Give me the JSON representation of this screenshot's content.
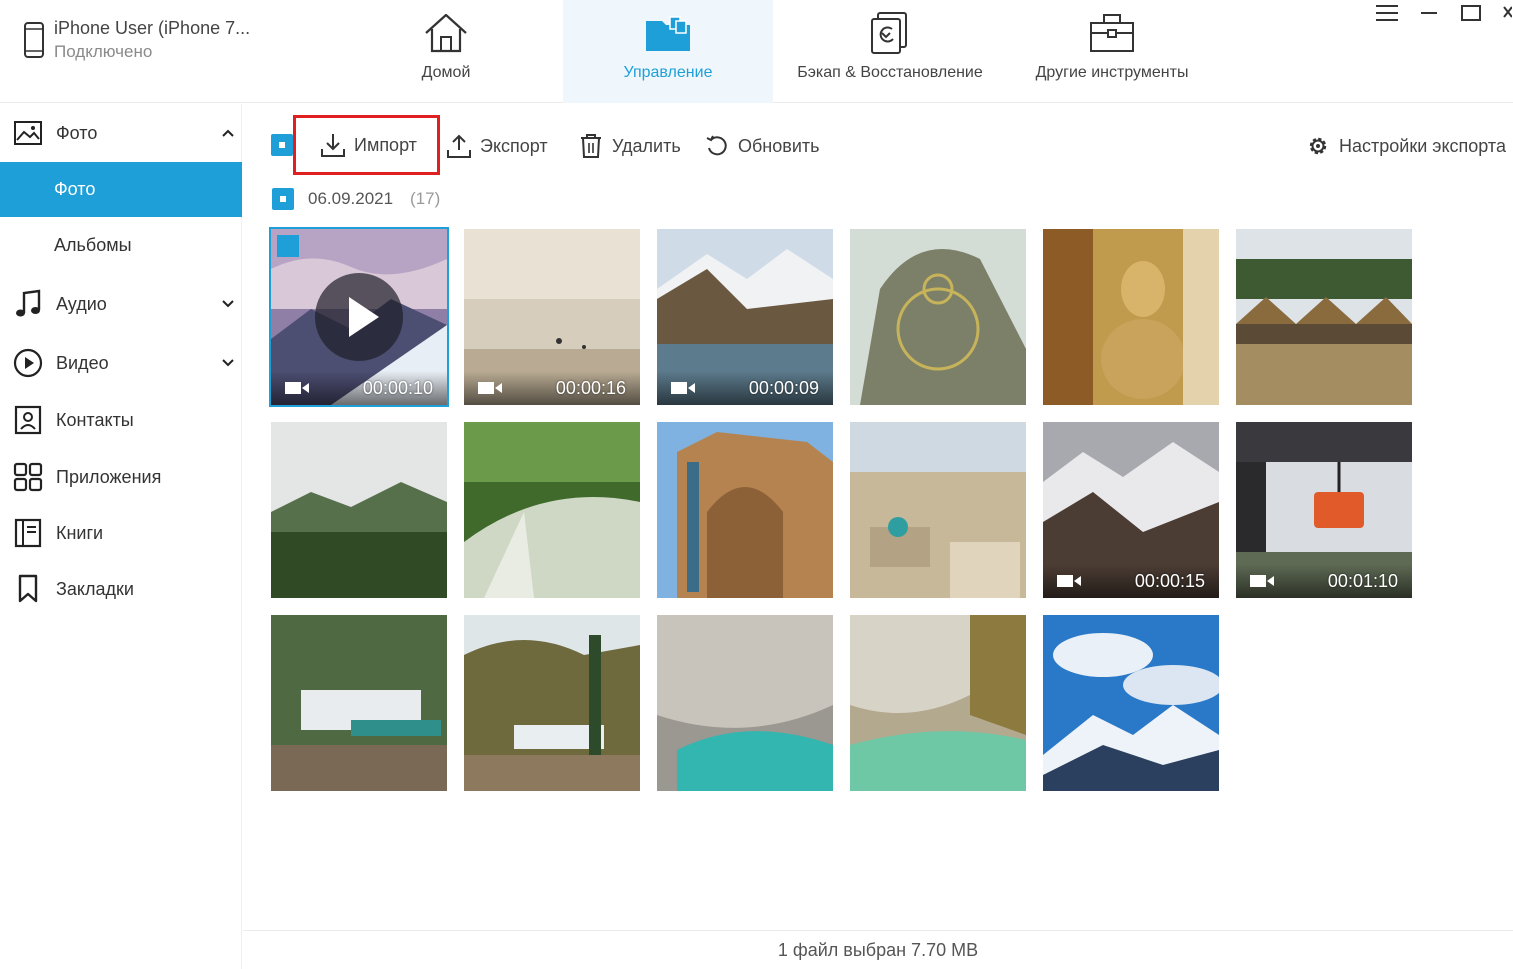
{
  "device": {
    "name": "iPhone User (iPhone 7...",
    "status": "Подключено"
  },
  "nav": {
    "tabs": [
      {
        "label": "Домой",
        "icon": "home-icon"
      },
      {
        "label": "Управление",
        "icon": "folder-icon",
        "active": true
      },
      {
        "label": "Бэкап & Восстановление",
        "icon": "backup-restore-icon"
      },
      {
        "label": "Другие инструменты",
        "icon": "toolbox-icon"
      }
    ]
  },
  "window_controls": [
    "menu-icon",
    "minimize-icon",
    "maximize-icon",
    "close-icon"
  ],
  "sidebar": {
    "items": [
      {
        "label": "Фото",
        "icon": "photo-icon",
        "expanded": true
      },
      {
        "label": "Фото",
        "sub": true,
        "active": true
      },
      {
        "label": "Альбомы",
        "sub": true
      },
      {
        "label": "Аудио",
        "icon": "music-note-icon"
      },
      {
        "label": "Видео",
        "icon": "play-circle-icon"
      },
      {
        "label": "Контакты",
        "icon": "contact-icon"
      },
      {
        "label": "Приложения",
        "icon": "apps-grid-icon"
      },
      {
        "label": "Книги",
        "icon": "book-icon"
      },
      {
        "label": "Закладки",
        "icon": "bookmark-icon"
      }
    ]
  },
  "toolbar": {
    "import_label": "Импорт",
    "export_label": "Экспорт",
    "delete_label": "Удалить",
    "refresh_label": "Обновить",
    "export_settings_label": "Настройки экспорта"
  },
  "group": {
    "date": "06.09.2021",
    "count": "(17)"
  },
  "photos": [
    {
      "video": true,
      "duration": "00:00:10",
      "selected": true
    },
    {
      "video": true,
      "duration": "00:00:16"
    },
    {
      "video": true,
      "duration": "00:00:09"
    },
    {
      "video": false
    },
    {
      "video": false
    },
    {
      "video": false
    },
    {
      "video": false
    },
    {
      "video": false
    },
    {
      "video": false
    },
    {
      "video": false
    },
    {
      "video": true,
      "duration": "00:00:15"
    },
    {
      "video": true,
      "duration": "00:01:10"
    },
    {
      "video": false
    },
    {
      "video": false
    },
    {
      "video": false
    },
    {
      "video": false
    },
    {
      "video": false
    }
  ],
  "status_text": "1 файл выбран 7.70 MB",
  "colors": {
    "accent": "#1e9fd8",
    "highlight": "#e02020"
  }
}
